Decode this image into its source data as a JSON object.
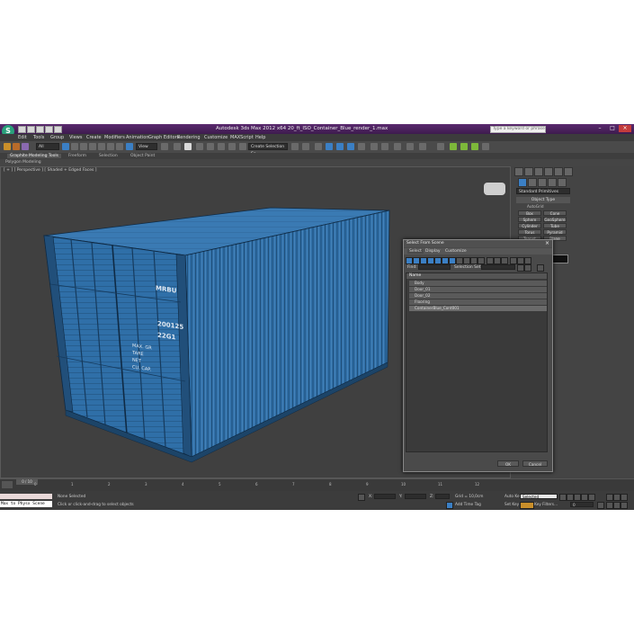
{
  "window": {
    "title": "Autodesk 3ds Max  2012 x64     20_ft_ISO_Container_Blue_render_1.max",
    "search_placeholder": "Type a keyword or phrase",
    "logo": "3ds-max-logo"
  },
  "menu": [
    "Edit",
    "Tools",
    "Group",
    "Views",
    "Create",
    "Modifiers",
    "Animation",
    "Graph Editors",
    "Rendering",
    "Customize",
    "MAXScript",
    "Help"
  ],
  "toolbar": {
    "selection_filter": "All",
    "view_dropdown": "View",
    "named_selection": "Create Selection Se"
  },
  "ribbon": {
    "tabs": [
      "Graphite Modeling Tools",
      "Freeform",
      "Selection",
      "Object Paint"
    ],
    "sub_label": "Polygon Modeling"
  },
  "viewport": {
    "label": "[ + ] [ Perspective ] [ Shaded + Edged Faces ]",
    "container_text": {
      "code1": "MRBU",
      "code2": "200125",
      "code3": "22G1",
      "specs": [
        "MAX. GR",
        "TARE",
        "NET",
        "CU. CAP."
      ]
    }
  },
  "command_panel": {
    "category": "Standard Primitives",
    "rollout": "Object Type",
    "autogrid": "AutoGrid",
    "buttons": [
      "Box",
      "Cone",
      "Sphere",
      "GeoSphere",
      "Cylinder",
      "Tube",
      "Torus",
      "Pyramid",
      "Teapot",
      "Plane"
    ]
  },
  "dialog": {
    "title": "Select From Scene",
    "menu": [
      "Select",
      "Display",
      "Customize"
    ],
    "find_label": "Find:",
    "selection_set": "Selection Set:",
    "column": "Name",
    "items": [
      "Body",
      "Door_01",
      "Door_02",
      "Flooring",
      "ContainerBlue_Cont001"
    ],
    "ok": "OK",
    "cancel": "Cancel"
  },
  "timeline": {
    "counter": "0 / 10",
    "ticks": [
      "0",
      "1",
      "2",
      "3",
      "4",
      "5",
      "6",
      "7",
      "8",
      "9",
      "10",
      "11",
      "12"
    ]
  },
  "status": {
    "script_listener": "Max to Physx Scene",
    "selection_state": "None Selected",
    "prompt": "Click or click-and-drag to select objects",
    "x_label": "X:",
    "y_label": "Y:",
    "z_label": "Z:",
    "grid": "Grid = 10,0cm",
    "add_time_tag": "Add Time Tag",
    "auto_key": "Auto Key",
    "key_mode": "Selected",
    "set_key": "Set Key",
    "key_filters": "Key Filters...",
    "frame": "0"
  },
  "colors": {
    "container_blue": "#2f6fa8",
    "title_purple": "#4a2160",
    "viewport_bg": "#404040"
  }
}
